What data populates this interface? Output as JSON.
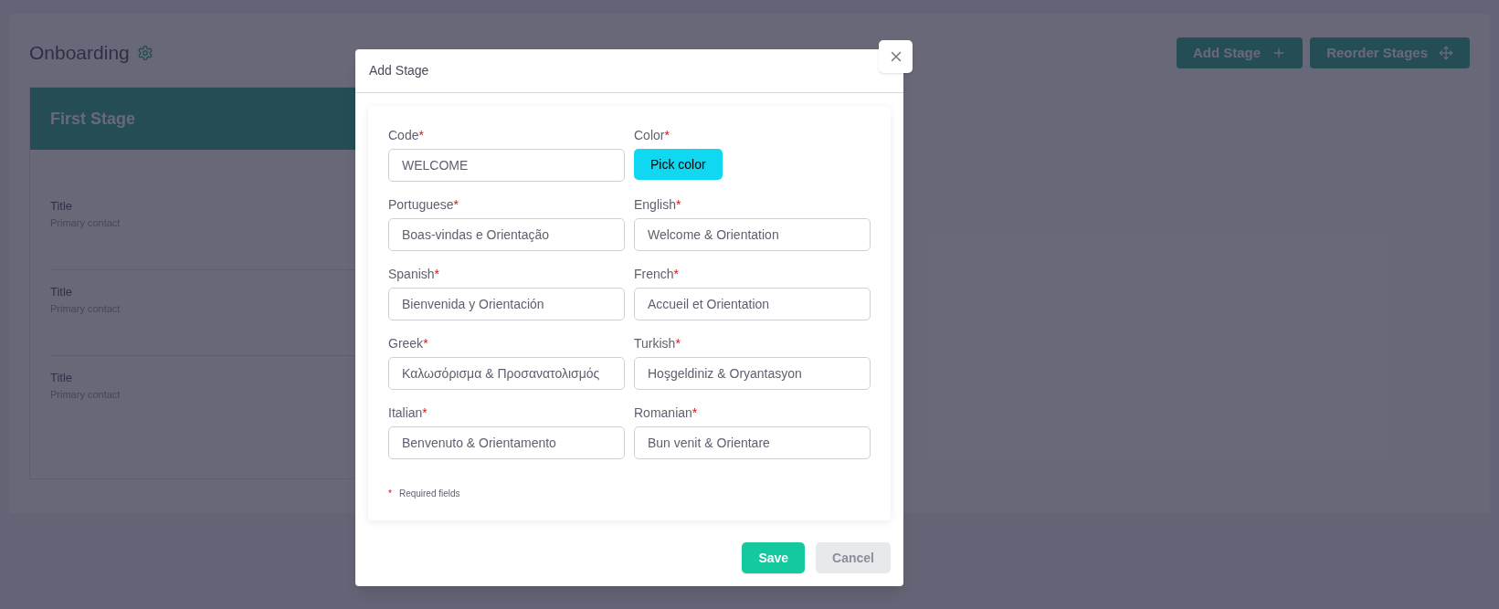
{
  "page": {
    "title": "Onboarding",
    "actions": [
      {
        "label": "Add Stage",
        "kind": "add"
      },
      {
        "label": "Reorder Stages",
        "kind": "move"
      }
    ]
  },
  "stage": {
    "title": "First Stage",
    "items": [
      {
        "title": "Title",
        "subtitle": "Primary contact"
      },
      {
        "title": "Title",
        "subtitle": "Primary contact"
      },
      {
        "title": "Title",
        "subtitle": "Primary contact"
      }
    ]
  },
  "dialog": {
    "title": "Add Stage",
    "fields": [
      {
        "kind": "text",
        "label": "Code",
        "required": true,
        "value": "WELCOME"
      },
      {
        "kind": "color",
        "label": "Color",
        "required": true,
        "value": "Pick color"
      },
      {
        "kind": "text",
        "label": "Portuguese",
        "required": true,
        "value": "Boas-vindas e Orientação"
      },
      {
        "kind": "text",
        "label": "English",
        "required": true,
        "value": "Welcome & Orientation"
      },
      {
        "kind": "text",
        "label": "Spanish",
        "required": true,
        "value": "Bienvenida y Orientación"
      },
      {
        "kind": "text",
        "label": "French",
        "required": true,
        "value": "Accueil et Orientation"
      },
      {
        "kind": "text",
        "label": "Greek",
        "required": true,
        "value": "Καλωσόρισμα & Προσανατολισμός"
      },
      {
        "kind": "text",
        "label": "Turkish",
        "required": true,
        "value": "Hoşgeldiniz & Oryantasyon"
      },
      {
        "kind": "text",
        "label": "Italian",
        "required": true,
        "value": "Benvenuto & Orientamento"
      },
      {
        "kind": "text",
        "label": "Romanian",
        "required": true,
        "value": "Bun venit & Orientare"
      }
    ],
    "required_note": {
      "mark": "*",
      "text": "Required fields"
    },
    "buttons": [
      {
        "label": "Save",
        "kind": "primary"
      },
      {
        "label": "Cancel",
        "kind": "secondary"
      }
    ]
  }
}
